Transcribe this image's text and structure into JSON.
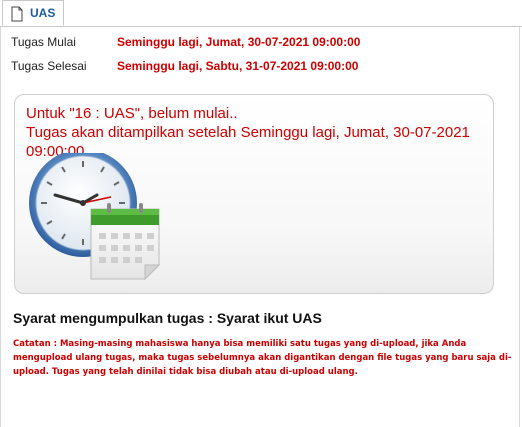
{
  "tab": {
    "label": "UAS",
    "icon": "document-icon"
  },
  "schedule": {
    "start_label": "Tugas Mulai",
    "start_value": "Seminggu lagi, Jumat, 30-07-2021 09:00:00",
    "end_label": "Tugas Selesai",
    "end_value": "Seminggu lagi, Sabtu, 31-07-2021 09:00:00"
  },
  "notice": {
    "line1": "Untuk \"16 : UAS\", belum mulai..",
    "line2": "Tugas akan ditampilkan setelah Seminggu lagi, Jumat, 30-07-2021 09:00:00",
    "illustration": "clock-calendar-icon"
  },
  "requirements": {
    "heading": "Syarat mengumpulkan tugas : Syarat ikut UAS",
    "note": "Catatan : Masing-masing mahasiswa hanya bisa memiliki satu tugas yang di-upload, jika Anda mengupload ulang tugas, maka tugas sebelumnya akan digantikan dengan file tugas yang baru saja di-upload. Tugas yang telah dinilai tidak bisa diubah atau di-upload ulang."
  },
  "colors": {
    "accent_red": "#cc0000",
    "tab_text": "#1d5a9e",
    "calendar_green": "#3f9b2c"
  }
}
